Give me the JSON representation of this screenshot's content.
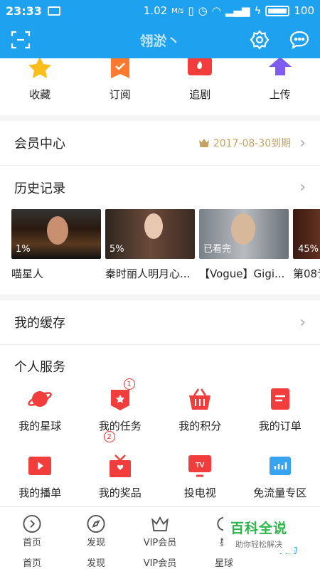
{
  "status_bar": {
    "time": "23:33",
    "speed": "1.02",
    "speed_unit": "M/s",
    "battery": "100"
  },
  "header": {
    "username": "翎淤丶"
  },
  "quick_actions": [
    {
      "label": "收藏",
      "icon": "star-icon"
    },
    {
      "label": "订阅",
      "icon": "subscribe-icon"
    },
    {
      "label": "追剧",
      "icon": "tv-follow-icon"
    },
    {
      "label": "上传",
      "icon": "upload-icon"
    }
  ],
  "vip_center": {
    "title": "会员中心",
    "expire": "2017-08-30到期"
  },
  "history": {
    "title": "历史记录",
    "items": [
      {
        "name": "喵星人",
        "progress": "1%"
      },
      {
        "name": "秦时丽人明月心...",
        "progress": "5%"
      },
      {
        "name": "【Vogue】Gigi...",
        "progress": "已看完"
      },
      {
        "name": "第08讠",
        "progress": "45%"
      }
    ]
  },
  "cache": {
    "title": "我的缓存"
  },
  "services": {
    "title": "个人服务",
    "items": [
      {
        "label": "我的星球",
        "icon": "planet-icon"
      },
      {
        "label": "我的任务",
        "icon": "task-icon",
        "badge": "1",
        "badge2": "2"
      },
      {
        "label": "我的积分",
        "icon": "basket-icon"
      },
      {
        "label": "我的订单",
        "icon": "order-icon"
      },
      {
        "label": "我的播单",
        "icon": "playlist-icon"
      },
      {
        "label": "我的奖品",
        "icon": "gift-icon"
      },
      {
        "label": "投电视",
        "icon": "tv-cast-icon"
      },
      {
        "label": "免流量专区",
        "icon": "data-free-icon"
      }
    ]
  },
  "tabbar": {
    "tabs": [
      {
        "label": "首页",
        "label2": "首页"
      },
      {
        "label": "发现",
        "label2": "发现"
      },
      {
        "label": "VIP会员",
        "label2": "VIP会员"
      },
      {
        "label": "星",
        "label2": "星球"
      },
      {
        "label": "",
        "label2": "我的"
      }
    ]
  },
  "watermark": {
    "line1": "百科全说",
    "line2": "助你轻松解决"
  }
}
